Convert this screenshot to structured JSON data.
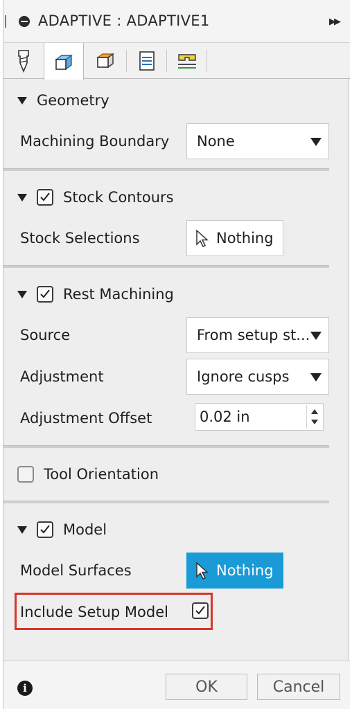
{
  "window": {
    "title": "ADAPTIVE : ADAPTIVE1"
  },
  "tabs": [
    {
      "icon": "tool-icon"
    },
    {
      "icon": "geometry-icon",
      "active": true
    },
    {
      "icon": "heights-icon"
    },
    {
      "icon": "passes-icon"
    },
    {
      "icon": "linking-icon"
    }
  ],
  "geometry": {
    "header": "Geometry",
    "machining_boundary_label": "Machining Boundary",
    "machining_boundary_value": "None"
  },
  "stock_contours": {
    "header": "Stock Contours",
    "checked": true,
    "stock_selections_label": "Stock Selections",
    "stock_selections_value": "Nothing"
  },
  "rest_machining": {
    "header": "Rest Machining",
    "checked": true,
    "source_label": "Source",
    "source_value": "From setup st...",
    "adjustment_label": "Adjustment",
    "adjustment_value": "Ignore cusps",
    "adjustment_offset_label": "Adjustment Offset",
    "adjustment_offset_value": "0.02 in"
  },
  "tool_orientation": {
    "header": "Tool Orientation",
    "checked": false
  },
  "model": {
    "header": "Model",
    "checked": true,
    "model_surfaces_label": "Model Surfaces",
    "model_surfaces_value": "Nothing",
    "include_setup_model_label": "Include Setup Model",
    "include_setup_model_checked": true
  },
  "footer": {
    "ok_label": "OK",
    "cancel_label": "Cancel"
  },
  "colors": {
    "accent_blue": "#1a9ad6",
    "highlight_red": "#d9352a"
  }
}
